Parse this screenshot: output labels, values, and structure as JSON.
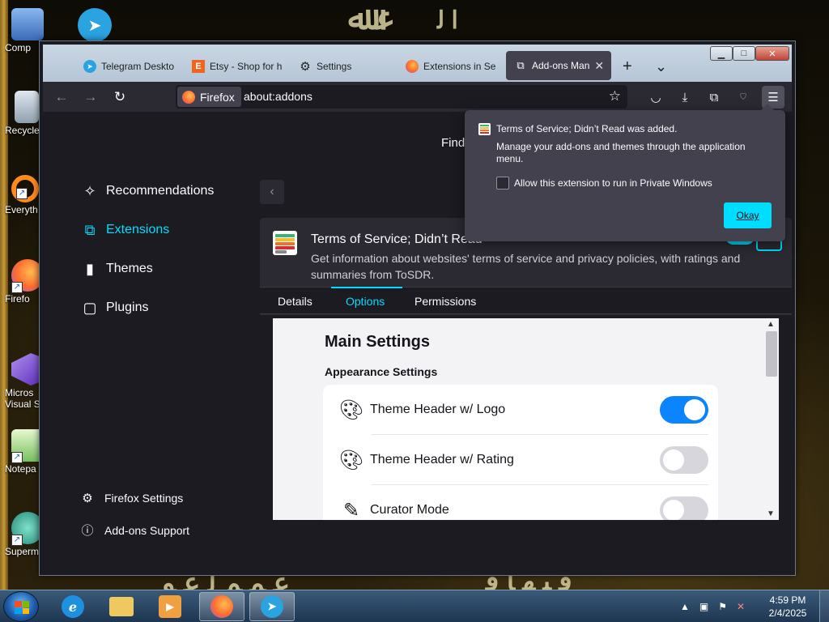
{
  "desktop": {
    "icons": [
      {
        "label": "Comp",
        "name": "desktop-icon-computer",
        "color": "#5a8ad8"
      },
      {
        "label": "Recycle",
        "name": "desktop-icon-recycle-bin",
        "color": "#a8b8c8"
      },
      {
        "label": "Everyth",
        "name": "desktop-icon-everything",
        "color": "#ff8a20"
      },
      {
        "label": "Firefo",
        "name": "desktop-icon-firefox",
        "color": "#ff6a30"
      },
      {
        "label": "Micros Visual St",
        "name": "desktop-icon-visual-studio",
        "color": "#7a4ad8"
      },
      {
        "label": "Notepa",
        "name": "desktop-icon-notepad",
        "color": "#7ac870"
      },
      {
        "label": "Superm",
        "name": "desktop-icon-supermium",
        "color": "#30b8a8"
      }
    ],
    "telegram_icon": "telegram-icon"
  },
  "browser": {
    "tabs": [
      {
        "label": "Telegram Deskto",
        "icon": "telegram-icon"
      },
      {
        "label": "Etsy - Shop for h",
        "icon": "etsy-icon"
      },
      {
        "label": "Settings",
        "icon": "gear-icon"
      },
      {
        "label": "Extensions in Se",
        "icon": "firefox-icon"
      },
      {
        "label": "Add-ons Man",
        "icon": "puzzle-icon"
      }
    ],
    "new_tab_symbol": "+",
    "tab_list_symbol": "⌄",
    "identity_label": "Firefox",
    "url": "about:addons"
  },
  "addons": {
    "find_label": "Find",
    "sidebar": [
      {
        "label": "Recommendations",
        "icon": "sparkle-icon"
      },
      {
        "label": "Extensions",
        "icon": "puzzle-icon"
      },
      {
        "label": "Themes",
        "icon": "brush-icon"
      },
      {
        "label": "Plugins",
        "icon": "plugin-icon"
      }
    ],
    "footer": [
      {
        "label": "Firefox Settings",
        "icon": "gear-icon"
      },
      {
        "label": "Add-ons Support",
        "icon": "help-icon"
      }
    ],
    "addon": {
      "name": "Terms of Service; Didn’t Read",
      "description": "Get information about websites' terms of service and privacy policies, with ratings and summaries from ToSDR."
    },
    "detail_tabs": [
      "Details",
      "Options",
      "Permissions"
    ],
    "options": {
      "title": "Main Settings",
      "section": "Appearance Settings",
      "rows": [
        {
          "label": "Theme Header w/ Logo",
          "icon": "palette-icon",
          "enabled": true
        },
        {
          "label": "Theme Header w/ Rating",
          "icon": "palette-icon",
          "enabled": false
        },
        {
          "label": "Curator Mode",
          "icon": "pencil-icon",
          "enabled": false
        }
      ]
    }
  },
  "popup": {
    "title": "Terms of Service; Didn’t Read was added.",
    "message": "Manage your add-ons and themes through the application menu.",
    "checkbox_label": "Allow this extension to run in Private Windows",
    "checkbox_checked": false,
    "okay_label": "Okay"
  },
  "taskbar": {
    "items": [
      "internet-explorer-icon",
      "file-explorer-icon",
      "media-player-icon",
      "firefox-icon",
      "telegram-icon"
    ],
    "clock_time": "4:59 PM",
    "clock_date": "2/4/2025"
  },
  "colors": {
    "accent": "#00ddff",
    "toggle_on": "#0a84ff",
    "toolbar": "#2b2a33",
    "content_bg": "#1c1b22"
  }
}
